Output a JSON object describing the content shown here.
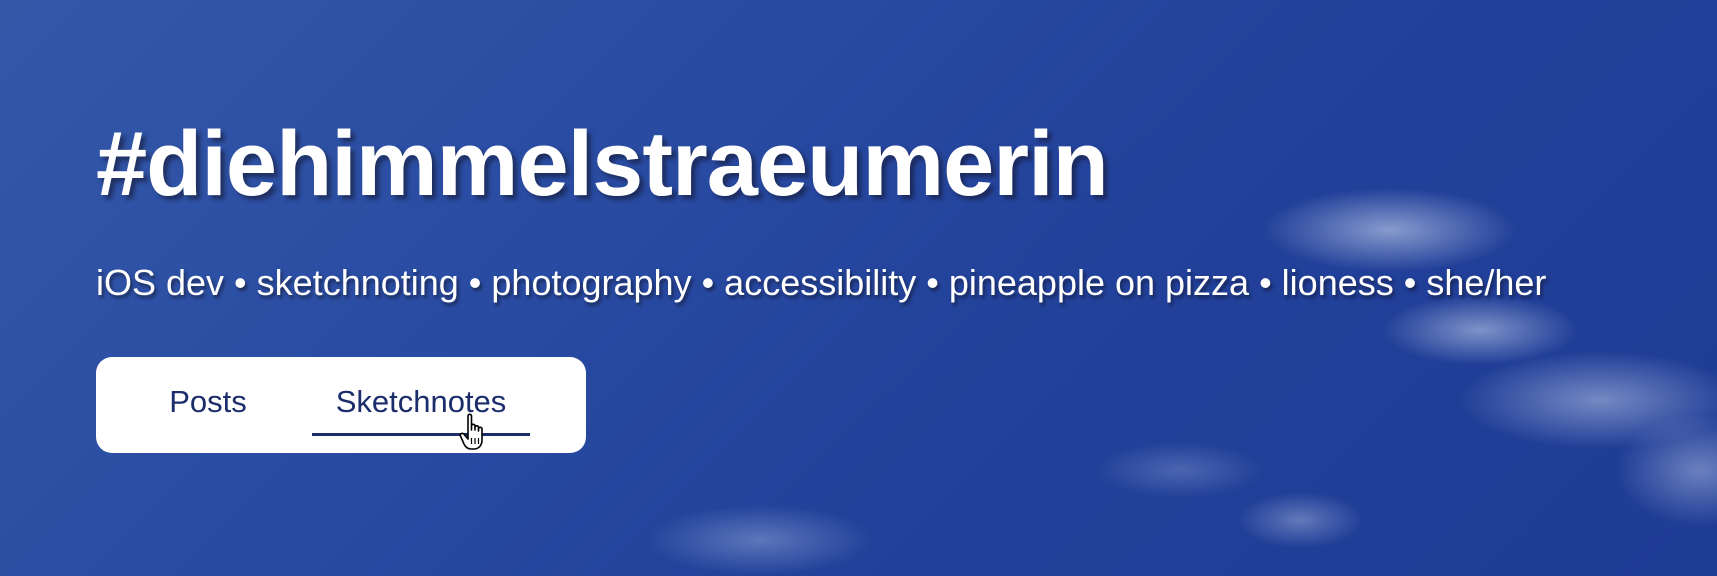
{
  "header": {
    "title": "#diehimmelstraeumerin",
    "tagline": "iOS dev • sketchnoting • photography • accessibility • pineapple on pizza • lioness • she/her"
  },
  "tabs": [
    {
      "label": "Posts",
      "selected": false
    },
    {
      "label": "Sketchnotes",
      "selected": true
    }
  ],
  "cursor": {
    "icon": "hand-pointer-icon"
  },
  "colors": {
    "sky": "#2a4da3",
    "tab_text": "#1b2d6b",
    "tab_background": "#ffffff"
  }
}
